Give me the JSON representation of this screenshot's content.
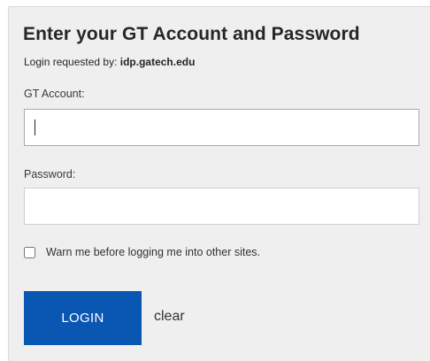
{
  "header": {
    "title": "Enter your GT Account and Password",
    "requested_prefix": "Login requested by: ",
    "requested_host": "idp.gatech.edu"
  },
  "form": {
    "account_label": "GT Account:",
    "account_value": "",
    "password_label": "Password:",
    "password_value": "",
    "warn_label": "Warn me before logging me into other sites.",
    "warn_checked": false,
    "login_label": "LOGIN",
    "clear_label": "clear"
  },
  "colors": {
    "panel_bg": "#efefef",
    "login_button_bg": "#0a56b3",
    "login_button_text": "#ffffff"
  }
}
